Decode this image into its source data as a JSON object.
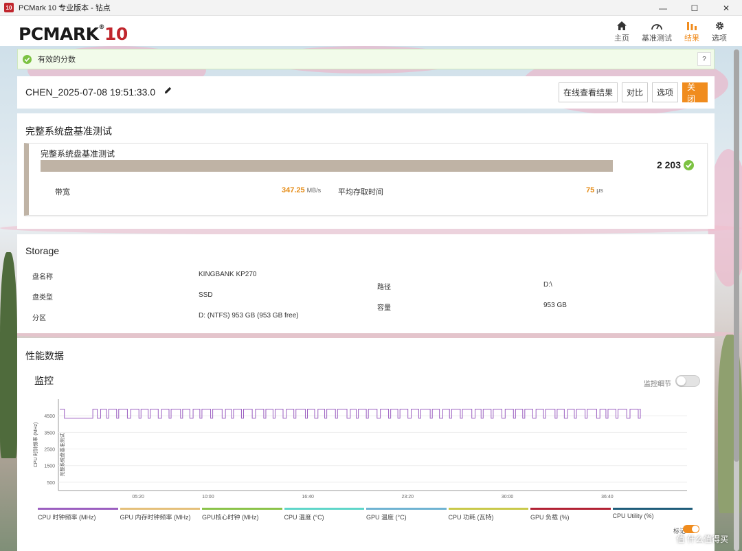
{
  "window": {
    "title": "PCMark 10 专业版本 - 钻点",
    "icon_text": "10",
    "minimize": "—",
    "maximize": "☐",
    "close": "✕"
  },
  "header": {
    "logo_main": "PCMARK",
    "logo_reg": "®",
    "logo_num": "10",
    "nav": [
      {
        "label": "主页",
        "icon": "home-icon"
      },
      {
        "label": "基准测试",
        "icon": "gauge-icon"
      },
      {
        "label": "结果",
        "icon": "bar-chart-icon",
        "active": true
      },
      {
        "label": "选项",
        "icon": "gear-icon"
      }
    ]
  },
  "banner": {
    "text": "有效的分数",
    "help": "?"
  },
  "result": {
    "name": "CHEN_2025-07-08 19:51:33.0",
    "buttons": {
      "online": "在线查看结果",
      "compare": "对比",
      "options": "选项",
      "close": "关闭"
    }
  },
  "benchmark": {
    "section_title": "完整系统盘基准测试",
    "card_title": "完整系统盘基准测试",
    "score": "2 203",
    "bandwidth_label": "带宽",
    "bandwidth_value": "347.25",
    "bandwidth_unit": "MB/s",
    "latency_label": "平均存取时间",
    "latency_value": "75",
    "latency_unit": "μs"
  },
  "storage": {
    "section_title": "Storage",
    "drive_name_label": "盘名称",
    "drive_name_value": "KINGBANK KP270",
    "drive_type_label": "盘类型",
    "drive_type_value": "SSD",
    "partition_label": "分区",
    "partition_value": "D: (NTFS) 953 GB (953 GB free)",
    "path_label": "路径",
    "path_value": "D:\\",
    "capacity_label": "容量",
    "capacity_value": "953 GB"
  },
  "performance": {
    "section_title": "性能数据",
    "monitor_title": "监控",
    "detail_label": "监控细节",
    "mark_label": "标记",
    "legend": [
      {
        "label": "CPU 时钟频率 (MHz)",
        "color": "#9b5fc0"
      },
      {
        "label": "GPU 内存时钟频率 (MHz)",
        "color": "#e5c07a"
      },
      {
        "label": "GPU核心时钟 (MHz)",
        "color": "#8bc34a"
      },
      {
        "label": "CPU 温度 (°C)",
        "color": "#5fd6c9"
      },
      {
        "label": "GPU 温度 (°C)",
        "color": "#6fb3d2"
      },
      {
        "label": "CPU 功耗 (瓦特)",
        "color": "#c9c94a"
      },
      {
        "label": "GPU 负载 (%)",
        "color": "#b22234"
      },
      {
        "label": "CPU Utility (%)",
        "color": "#1f5d7a"
      }
    ]
  },
  "chart_data": {
    "type": "line",
    "ylabel": "CPU 时钟频率 (MHz)",
    "yticks": [
      500,
      1500,
      2500,
      3500,
      4500
    ],
    "xticks": [
      "05:20",
      "10:00",
      "16:40",
      "23:20",
      "30:00",
      "36:40"
    ],
    "annotation": "完整系统盘基准测试",
    "ylim": [
      0,
      5500
    ],
    "series": [
      {
        "name": "CPU 时钟频率 (MHz)",
        "high": 4900,
        "low": 4350,
        "x_end_minutes": 38.8
      }
    ]
  },
  "watermark": "值 什么值得买"
}
